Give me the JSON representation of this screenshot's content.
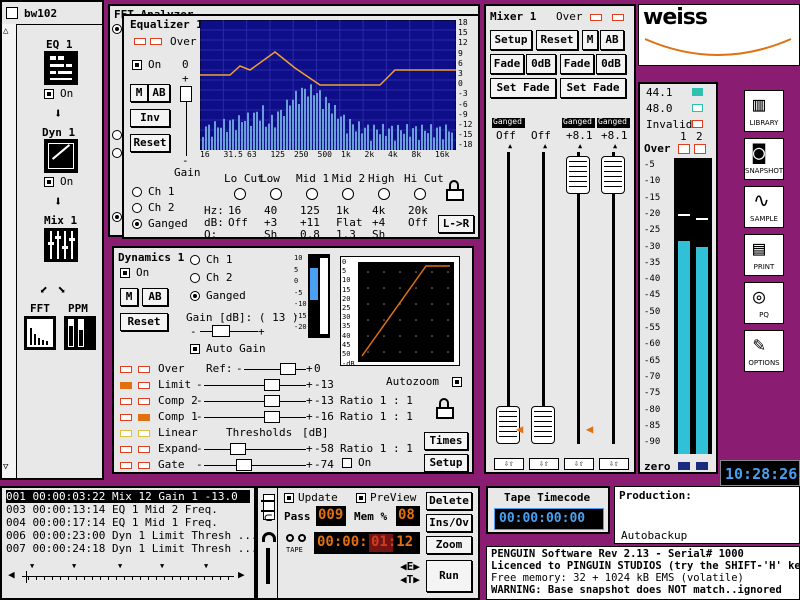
{
  "left": {
    "title": "bw102",
    "eq": "EQ 1",
    "dyn": "Dyn 1",
    "mix": "Mix 1",
    "on": "On",
    "fft": "FFT",
    "ppm": "PPM"
  },
  "fft_title": "FFT Analyzer",
  "equalizer": {
    "title": "Equalizer 1",
    "over": "Over",
    "on": "On",
    "m": "M",
    "ab": "AB",
    "inv": "Inv",
    "reset": "Reset",
    "gain_label": "Gain",
    "gain_value": "0",
    "plus": "+",
    "minus": "-",
    "ch1": "Ch 1",
    "ch2": "Ch 2",
    "ganged": "Ganged",
    "freq_ticks": [
      "16",
      "31.5",
      "63",
      "125",
      "250",
      "500",
      "1k",
      "2k",
      "4k",
      "8k",
      "16k"
    ],
    "db_ticks": [
      "18",
      "15",
      "12",
      "9",
      "6",
      "3",
      "0",
      "-3",
      "-6",
      "-9",
      "-12",
      "-15",
      "-18"
    ],
    "row_labels": [
      "Hz:",
      "dB:",
      "Q:"
    ],
    "bands": [
      {
        "name": "Lo Cut",
        "hz": "16",
        "db": "Off",
        "q": ""
      },
      {
        "name": "Low",
        "hz": "40",
        "db": "+3",
        "q": "Sh"
      },
      {
        "name": "Mid 1",
        "hz": "125",
        "db": "+11",
        "q": "0.8"
      },
      {
        "name": "Mid 2",
        "hz": "1k",
        "db": "Flat",
        "q": "1.3"
      },
      {
        "name": "High",
        "hz": "4k",
        "db": "+4",
        "q": "Sh"
      },
      {
        "name": "Hi Cut",
        "hz": "20k",
        "db": "Off",
        "q": ""
      }
    ],
    "lr": "L->R"
  },
  "dynamics": {
    "title": "Dynamics 1",
    "on": "On",
    "m": "M",
    "ab": "AB",
    "reset": "Reset",
    "ch1": "Ch 1",
    "ch2": "Ch 2",
    "ganged": "Ganged",
    "gain_label": "Gain [dB]: ( 13 )",
    "auto_gain": "Auto Gain",
    "ref_label": "Ref:",
    "thresholds": "Thresholds",
    "db_unit": "[dB]",
    "rows": [
      {
        "name": "Over",
        "value": "0",
        "ratio": ""
      },
      {
        "name": "Limit",
        "value": "-13",
        "ratio": ""
      },
      {
        "name": "Comp 2",
        "value": "-13",
        "ratio": "Ratio 1 : 1"
      },
      {
        "name": "Comp 1",
        "value": "-16",
        "ratio": "Ratio 1 : 1"
      },
      {
        "name": "Linear",
        "value": "",
        "ratio": ""
      },
      {
        "name": "Expand",
        "value": "-58",
        "ratio": "Ratio 1 : 1"
      },
      {
        "name": "Gate",
        "value": "-74",
        "ratio": ""
      }
    ],
    "gate_on": "On",
    "times": "Times",
    "setup": "Setup",
    "autozoom": "Autozoom",
    "meter_ticks": [
      "10",
      "5",
      "0",
      "-5",
      "-10",
      "-15",
      "-20"
    ],
    "graph_db": [
      "0",
      "5",
      "10",
      "15",
      "20",
      "25",
      "30",
      "35",
      "40",
      "45",
      "50"
    ],
    "graph_unit": "-dB"
  },
  "mixer": {
    "title": "Mixer 1",
    "over": "Over",
    "setup": "Setup",
    "reset": "Reset",
    "m": "M",
    "ab": "AB",
    "fade": "Fade",
    "zero_db": "0dB",
    "set_fade": "Set Fade",
    "channels": [
      {
        "label": "Ganged",
        "value": "Off"
      },
      {
        "label": "",
        "value": "Off"
      },
      {
        "label": "Ganged",
        "value": "+8.1"
      },
      {
        "label": "Ganged",
        "value": "+8.1"
      }
    ]
  },
  "meter": {
    "rates": [
      "44.1",
      "48.0",
      "Invalid"
    ],
    "ch": [
      "1",
      "2"
    ],
    "over": "Over",
    "scale": [
      "-5",
      "-10",
      "-15",
      "-20",
      "-25",
      "-30",
      "-35",
      "-40",
      "-45",
      "-50",
      "-55",
      "-60",
      "-65",
      "-70",
      "-75",
      "-80",
      "-85",
      "-90"
    ],
    "zero": "zero",
    "left_level": 0.72,
    "right_level": 0.7
  },
  "brand": "weiss",
  "side_buttons": [
    {
      "label": "LIBRARY",
      "icon": "library-icon"
    },
    {
      "label": "SNAPSHOT",
      "icon": "camera-icon"
    },
    {
      "label": "SAMPLE",
      "icon": "sample-icon"
    },
    {
      "label": "PRINT",
      "icon": "printer-icon"
    },
    {
      "label": "PQ",
      "icon": "disc-icon"
    },
    {
      "label": "OPTIONS",
      "icon": "wrench-icon"
    }
  ],
  "clock": "10:28:26",
  "log": [
    "001 00:00:03:22 Mix 12 Gain 1 -13.0",
    "003 00:00:13:14 EQ 1 Mid 2 Freq.",
    "004 00:00:17:14 EQ 1 Mid 1 Freq.",
    "006 00:00:23:00 Dyn 1 Limit Thresh ...",
    "007 00:00:24:18 Dyn 1 Limit Thresh ..."
  ],
  "transport": {
    "update": "Update",
    "preview": "PreView",
    "pass": "Pass",
    "pass_value": "009",
    "mem": "Mem %",
    "mem_value": "08",
    "tape": "TAPE",
    "time_a": "00:00:",
    "time_b": "01:12",
    "delete": "Delete",
    "insov": "Ins/Ov",
    "zoom": "Zoom",
    "run": "Run"
  },
  "tape_tc": {
    "label": "Tape Timecode",
    "value": "00:00:00:00"
  },
  "production": {
    "label": "Production:",
    "value": "Autobackup"
  },
  "status": [
    "PENGUIN Software Rev  2.13 - Serial# 1000",
    "Licenced to PINGUIN STUDIOS (try the SHIFT-'H' key",
    "Free memory:  32 + 1024 kB EMS (volatile)",
    "WARNING: Base snapshot does NOT match..ignored"
  ],
  "colors": {
    "accent": "#e07010",
    "curve": "#f0a030",
    "spectrum": "#6a9ed8",
    "plot_bg": "#0e0e88",
    "lcd_orange": "#e07010",
    "lcd_blue": "#4aa0f0",
    "meter": "#30c0d8"
  }
}
